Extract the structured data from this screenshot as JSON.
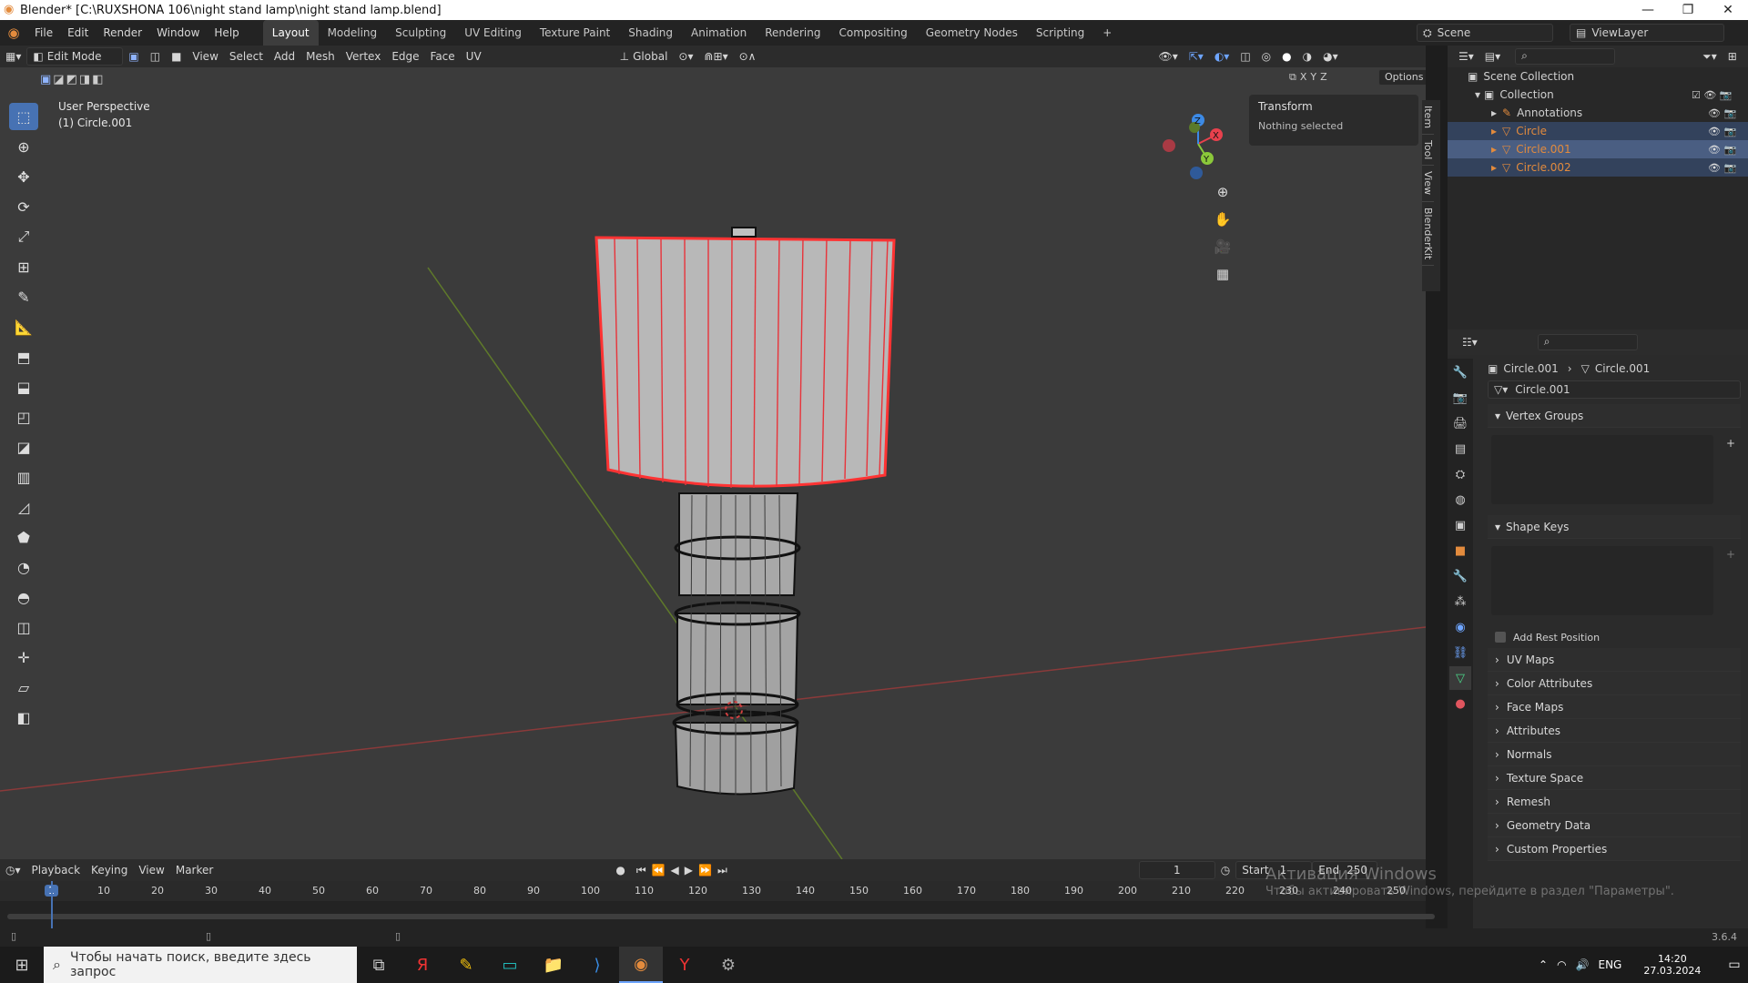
{
  "title_bar": {
    "title": "Blender* [C:\\RUXSHONA 106\\night stand lamp\\night stand lamp.blend]",
    "minimize": "—",
    "maximize": "❐",
    "close": "✕"
  },
  "menu": {
    "items": [
      "File",
      "Edit",
      "Render",
      "Window",
      "Help"
    ],
    "workspaces": [
      "Layout",
      "Modeling",
      "Sculpting",
      "UV Editing",
      "Texture Paint",
      "Shading",
      "Animation",
      "Rendering",
      "Compositing",
      "Geometry Nodes",
      "Scripting"
    ],
    "add_tab": "+",
    "scene": "Scene",
    "view_layer": "ViewLayer"
  },
  "viewport_header": {
    "mode": "Edit Mode",
    "items": [
      "View",
      "Select",
      "Add",
      "Mesh",
      "Vertex",
      "Edge",
      "Face",
      "UV"
    ],
    "orientation": "Global",
    "options": "Options",
    "axes": [
      "X",
      "Y",
      "Z"
    ]
  },
  "viewport": {
    "perspective": "User Perspective",
    "object": "(1) Circle.001"
  },
  "npanel": {
    "tabs": [
      "Item",
      "Tool",
      "View",
      "BlenderKit"
    ],
    "transform_title": "Transform",
    "transform_body": "Nothing selected"
  },
  "gizmo": {
    "x": "X",
    "y": "Y",
    "z": "Z",
    "colors": {
      "x": "#e8414d",
      "y": "#8bc83a",
      "z": "#3c8ae6"
    }
  },
  "timeline": {
    "menu": [
      "Playback",
      "Keying",
      "View",
      "Marker"
    ],
    "current_frame": "1",
    "start_label": "Start",
    "start": "1",
    "end_label": "End",
    "end": "250",
    "ticks": [
      "1",
      "10",
      "20",
      "30",
      "40",
      "50",
      "60",
      "70",
      "80",
      "90",
      "100",
      "110",
      "120",
      "130",
      "140",
      "150",
      "160",
      "170",
      "180",
      "190",
      "200",
      "210",
      "220",
      "230",
      "240",
      "250"
    ]
  },
  "outliner": {
    "scene_collection": "Scene Collection",
    "collection": "Collection",
    "items": [
      "Annotations",
      "Circle",
      "Circle.001",
      "Circle.002"
    ]
  },
  "properties": {
    "breadcrumb_object": "Circle.001",
    "breadcrumb_data": "Circle.001",
    "data_name": "Circle.001",
    "sections": [
      "Vertex Groups",
      "Shape Keys"
    ],
    "add_rest_position": "Add Rest Position",
    "collapsed": [
      "UV Maps",
      "Color Attributes",
      "Face Maps",
      "Attributes",
      "Normals",
      "Texture Space",
      "Remesh",
      "Geometry Data",
      "Custom Properties"
    ]
  },
  "watermark": {
    "line1": "Активация Windows",
    "line2": "Чтобы активировать Windows, перейдите в раздел \"Параметры\"."
  },
  "status": {
    "version": "3.6.4"
  },
  "taskbar": {
    "search_placeholder": "Чтобы начать поиск, введите здесь запрос",
    "lang": "ENG",
    "time": "14:20",
    "date": "27.03.2024"
  },
  "colors": {
    "accent": "#4772b3",
    "selected_edge": "#ff3333",
    "orange": "#e38b3d"
  }
}
